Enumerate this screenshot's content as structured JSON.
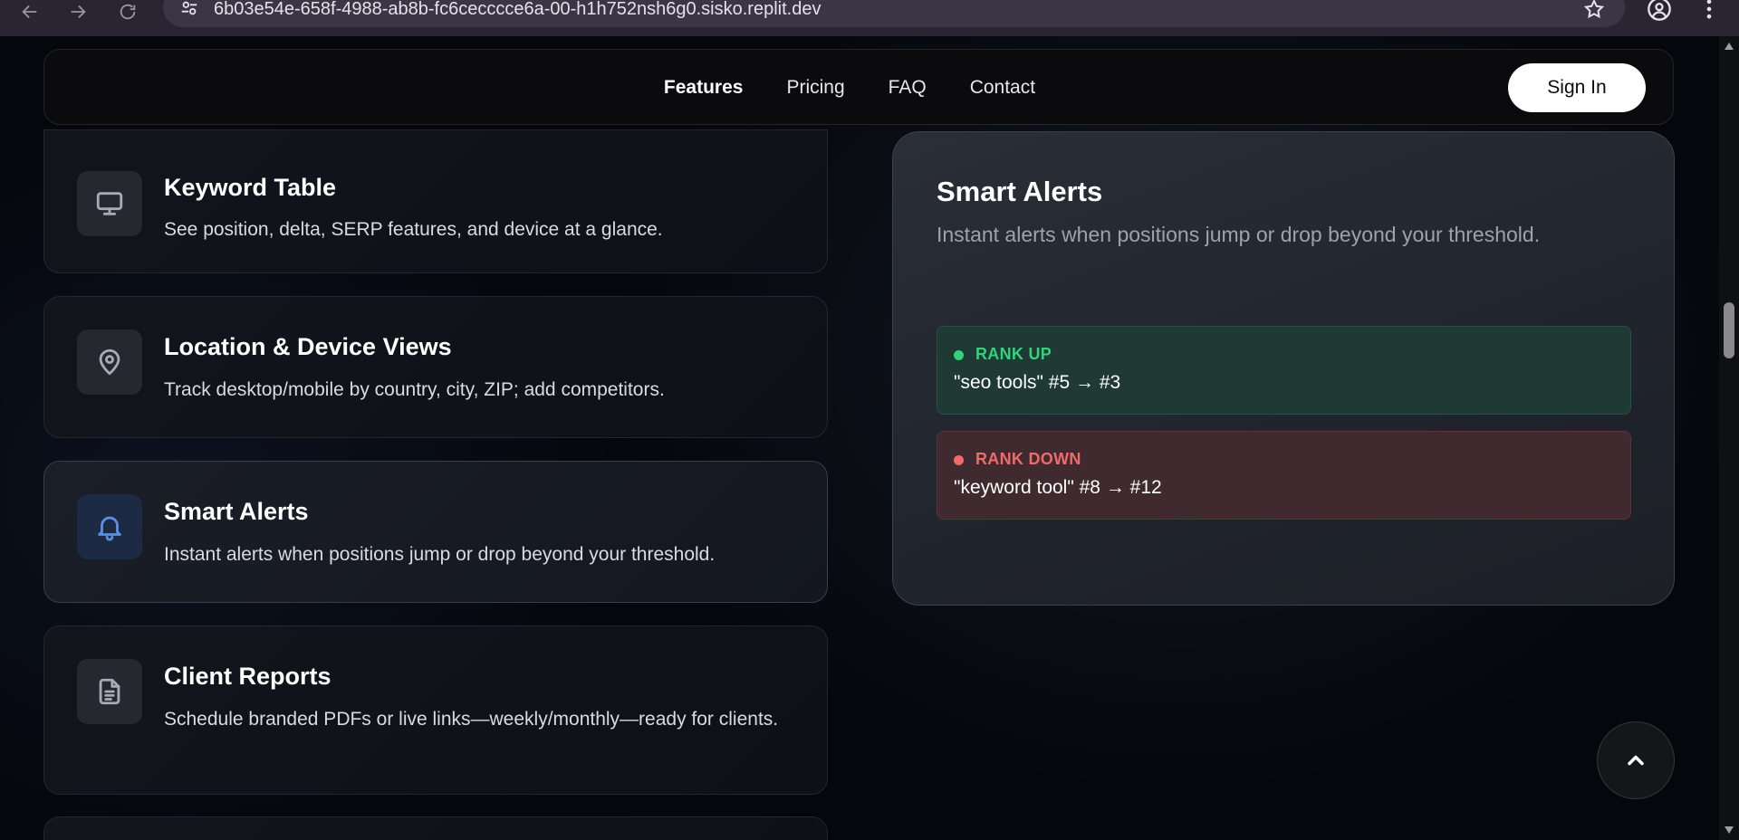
{
  "browser": {
    "url": "6b03e54e-658f-4988-ab8b-fc6cecccce6a-00-h1h752nsh6g0.sisko.replit.dev"
  },
  "nav": {
    "items": [
      {
        "label": "Features",
        "active": true
      },
      {
        "label": "Pricing",
        "active": false
      },
      {
        "label": "FAQ",
        "active": false
      },
      {
        "label": "Contact",
        "active": false
      }
    ],
    "sign_in": "Sign In"
  },
  "features": [
    {
      "title": "Keyword Table",
      "desc": "See position, delta, SERP features, and device at a glance.",
      "icon": "monitor-icon"
    },
    {
      "title": "Location & Device Views",
      "desc": "Track desktop/mobile by country, city, ZIP; add competitors.",
      "icon": "map-pin-icon"
    },
    {
      "title": "Smart Alerts",
      "desc": "Instant alerts when positions jump or drop beyond your threshold.",
      "icon": "bell-icon",
      "active": true
    },
    {
      "title": "Client Reports",
      "desc": "Schedule branded PDFs or live links—weekly/monthly—ready for clients.",
      "icon": "document-icon"
    }
  ],
  "panel": {
    "title": "Smart Alerts",
    "desc": "Instant alerts when positions jump or drop beyond your threshold.",
    "alerts": [
      {
        "tag": "RANK UP",
        "msg": "\"seo tools\" #5 → #3",
        "color": "#34d17c"
      },
      {
        "tag": "RANK DOWN",
        "msg": "\"keyword tool\" #8 → #12",
        "color": "#ef6b6b"
      }
    ]
  },
  "colors": {
    "accent": "#5b8fe6",
    "up": "#34d17c",
    "down": "#ef6b6b"
  }
}
